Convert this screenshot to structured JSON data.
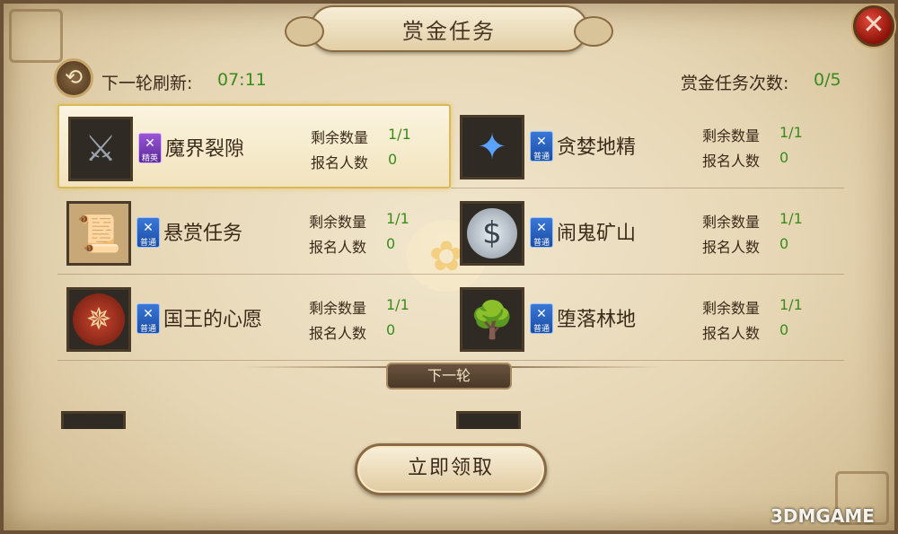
{
  "title": "赏金任务",
  "close_icon": "close-icon",
  "refresh": {
    "label": "下一轮刷新:",
    "time": "07:11",
    "icon": "refresh-icon"
  },
  "bounty_count": {
    "label": "赏金任务次数:",
    "value": "0/5"
  },
  "stats_labels": {
    "remaining": "剩余数量",
    "signed_up": "报名人数"
  },
  "tasks": [
    {
      "name": "魔界裂隙",
      "remaining": "1/1",
      "signed_up": "0",
      "badge": "精英",
      "badge_color": "#8a4ad0",
      "icon": "rift-icon",
      "selected": true
    },
    {
      "name": "贪婪地精",
      "remaining": "1/1",
      "signed_up": "0",
      "badge": "普通",
      "badge_color": "#2a66c8",
      "icon": "crystal-icon",
      "selected": false
    },
    {
      "name": "悬赏任务",
      "remaining": "1/1",
      "signed_up": "0",
      "badge": "普通",
      "badge_color": "#2a66c8",
      "icon": "scroll-icon",
      "selected": false
    },
    {
      "name": "闹鬼矿山",
      "remaining": "1/1",
      "signed_up": "0",
      "badge": "普通",
      "badge_color": "#2a66c8",
      "icon": "silver-coin-icon",
      "selected": false
    },
    {
      "name": "国王的心愿",
      "remaining": "1/1",
      "signed_up": "0",
      "badge": "普通",
      "badge_color": "#2a66c8",
      "icon": "compass-icon",
      "selected": false
    },
    {
      "name": "堕落林地",
      "remaining": "1/1",
      "signed_up": "0",
      "badge": "普通",
      "badge_color": "#2a66c8",
      "icon": "forest-icon",
      "selected": false
    }
  ],
  "next_round_label": "下一轮",
  "claim_button": "立即领取",
  "watermark": "3DMGAME"
}
